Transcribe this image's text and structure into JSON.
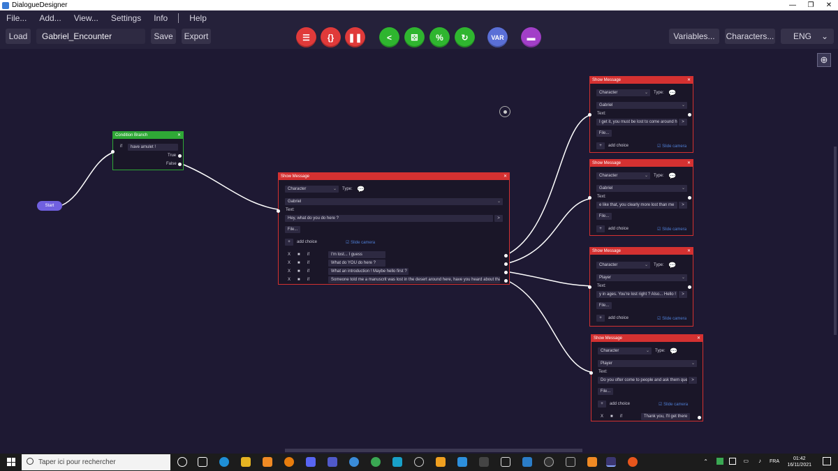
{
  "window": {
    "title": "DialogueDesigner",
    "minimize": "—",
    "maximize": "❐",
    "close": "✕"
  },
  "menu": {
    "file": "File...",
    "add": "Add...",
    "view": "View...",
    "settings": "Settings",
    "info": "Info",
    "help": "Help"
  },
  "toolbar": {
    "load": "Load",
    "filename": "Gabriel_Encounter",
    "save": "Save",
    "export": "Export",
    "variables": "Variables...",
    "characters": "Characters...",
    "language": "ENG",
    "var_label": "VAR",
    "colors": {
      "red": "#e03a3a",
      "green": "#2fb52f",
      "blue": "#5a6fd6",
      "purple": "#a23fc8"
    }
  },
  "nodes": {
    "start": {
      "label": "Start"
    },
    "condition": {
      "title": "Condition Branch",
      "if_label": "if",
      "condition": "have amulet !",
      "true_label": "True",
      "false_label": "False"
    },
    "main": {
      "title": "Show Message",
      "character_type": "Character",
      "type_label": "Type:",
      "character": "Gabriel",
      "text_label": "Text:",
      "text": "Hey, what do you do here ?",
      "file_label": "File...",
      "add_choice": "add choice",
      "slide_camera": "Slide camera",
      "choices": [
        "I'm lost... I guess",
        "What do YOU do here ?",
        "What an introduction ! Maybe hello first ?",
        "Someone told me a manuscrit was lost in the desert around here, have you heard about that ?"
      ]
    },
    "reply1": {
      "title": "Show Message",
      "character_type": "Character",
      "type_label": "Type:",
      "character": "Gabriel",
      "text_label": "Text:",
      "text": "I get it, you must be lost to come around h",
      "file_label": "File...",
      "add_choice": "add choice",
      "slide_camera": "Slide camera"
    },
    "reply2": {
      "title": "Show Message",
      "character_type": "Character",
      "type_label": "Type:",
      "character": "Gabriel",
      "text_label": "Text:",
      "text": "e like that, you clearly more lost than me",
      "file_label": "File...",
      "add_choice": "add choice",
      "slide_camera": "Slide camera"
    },
    "reply3": {
      "title": "Show Message",
      "character_type": "Character",
      "type_label": "Type:",
      "character": "Player",
      "text_label": "Text:",
      "text": "y in ages. You're lost right ? Also... Hello !",
      "file_label": "File...",
      "add_choice": "add choice",
      "slide_camera": "Slide camera"
    },
    "reply4": {
      "title": "Show Message",
      "character_type": "Character",
      "type_label": "Type:",
      "character": "Player",
      "text_label": "Text:",
      "text": "Do you ofter come to people and ask them que",
      "file_label": "File...",
      "add_choice": "add choice",
      "slide_camera": "Slide camera",
      "choice": "Thank you, I'll get there"
    }
  },
  "taskbar": {
    "search_placeholder": "Taper ici pour rechercher",
    "language": "FRA",
    "time": "01:42",
    "date": "16/11/2021"
  }
}
